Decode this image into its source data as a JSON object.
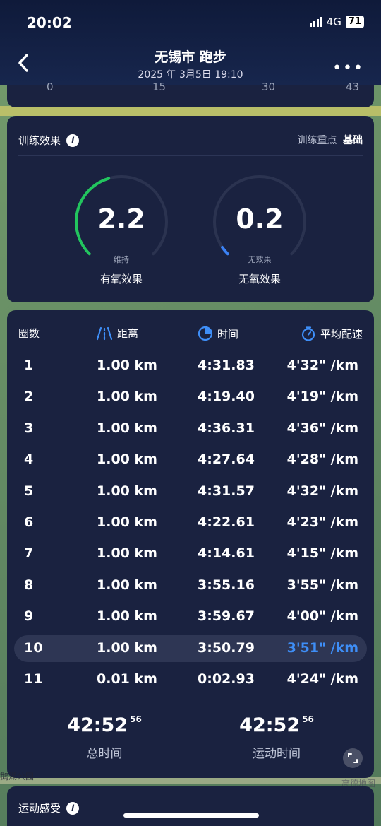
{
  "status_bar": {
    "time": "20:02",
    "network": "4G",
    "battery": "71"
  },
  "header": {
    "title": "无锡市 跑步",
    "subtitle": "2025 年 3月5日 19:10",
    "more_label": "•••"
  },
  "axis_ticks": [
    "0",
    "15",
    "30",
    "43"
  ],
  "training_effect": {
    "title": "训练效果",
    "focus_label": "训练重点",
    "focus_value": "基础",
    "aerobic": {
      "value": "2.2",
      "status": "维持",
      "name": "有氧效果",
      "level": 0.44,
      "color": "#22c55e"
    },
    "anaerobic": {
      "value": "0.2",
      "status": "无效果",
      "name": "无氧效果",
      "level": 0.04,
      "color": "#3b82f6"
    }
  },
  "laps": {
    "headers": {
      "lap": "圈数",
      "distance": "距离",
      "time": "时间",
      "pace": "平均配速"
    },
    "rows": [
      {
        "lap": "1",
        "distance": "1.00 km",
        "time": "4:31.83",
        "pace": "4'32\" /km"
      },
      {
        "lap": "2",
        "distance": "1.00 km",
        "time": "4:19.40",
        "pace": "4'19\" /km"
      },
      {
        "lap": "3",
        "distance": "1.00 km",
        "time": "4:36.31",
        "pace": "4'36\" /km"
      },
      {
        "lap": "4",
        "distance": "1.00 km",
        "time": "4:27.64",
        "pace": "4'28\" /km"
      },
      {
        "lap": "5",
        "distance": "1.00 km",
        "time": "4:31.57",
        "pace": "4'32\" /km"
      },
      {
        "lap": "6",
        "distance": "1.00 km",
        "time": "4:22.61",
        "pace": "4'23\" /km"
      },
      {
        "lap": "7",
        "distance": "1.00 km",
        "time": "4:14.61",
        "pace": "4'15\" /km"
      },
      {
        "lap": "8",
        "distance": "1.00 km",
        "time": "3:55.16",
        "pace": "3'55\" /km"
      },
      {
        "lap": "9",
        "distance": "1.00 km",
        "time": "3:59.67",
        "pace": "4'00\" /km"
      },
      {
        "lap": "10",
        "distance": "1.00 km",
        "time": "3:50.79",
        "pace": "3'51\" /km"
      },
      {
        "lap": "11",
        "distance": "0.01 km",
        "time": "0:02.93",
        "pace": "4'24\" /km"
      }
    ],
    "highlight_lap": "10",
    "accent_color": "#3e8ef7"
  },
  "totals": {
    "total_time": {
      "main": "42:52",
      "sub": "56",
      "label": "总时间"
    },
    "moving_time": {
      "main": "42:52",
      "sub": "56",
      "label": "运动时间"
    }
  },
  "feel": {
    "title": "运动感受"
  },
  "map_labels": {
    "left": "鹅湖公园",
    "right": "高德地图"
  }
}
